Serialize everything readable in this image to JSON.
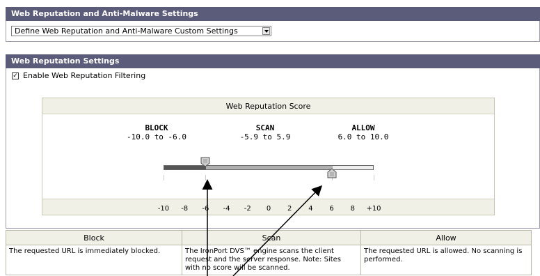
{
  "section1": {
    "title": "Web Reputation and Anti-Malware Settings",
    "select_value": "Define Web Reputation and Anti-Malware Custom Settings"
  },
  "section2": {
    "title": "Web Reputation Settings",
    "checkbox_label": "Enable Web Reputation Filtering",
    "checkbox_checked": true
  },
  "score": {
    "title": "Web Reputation Score",
    "zones": [
      {
        "name": "BLOCK",
        "range": "-10.0 to -6.0"
      },
      {
        "name": "SCAN",
        "range": "-5.9 to 5.9"
      },
      {
        "name": "ALLOW",
        "range": "6.0 to 10.0"
      }
    ],
    "min": -10,
    "max": 10,
    "block_threshold": -6,
    "allow_threshold": 6,
    "ticks": [
      "-10",
      "-8",
      "-6",
      "-4",
      "-2",
      "0",
      "2",
      "4",
      "6",
      "8",
      "+10"
    ]
  },
  "table": {
    "headers": [
      "Block",
      "Scan",
      "Allow"
    ],
    "block_text": "The requested URL is immediately blocked.",
    "scan_text": "The IronPort DVS™ engine scans the client request and the server response. Note: Sites with no score will be scanned.",
    "allow_text": "The requested URL is allowed. No scanning is performed."
  },
  "colors": {
    "header_bg": "#5b5b7a",
    "track_block": "#555555",
    "track_scan": "#b0b0b0",
    "track_allow": "#eeeeee"
  }
}
